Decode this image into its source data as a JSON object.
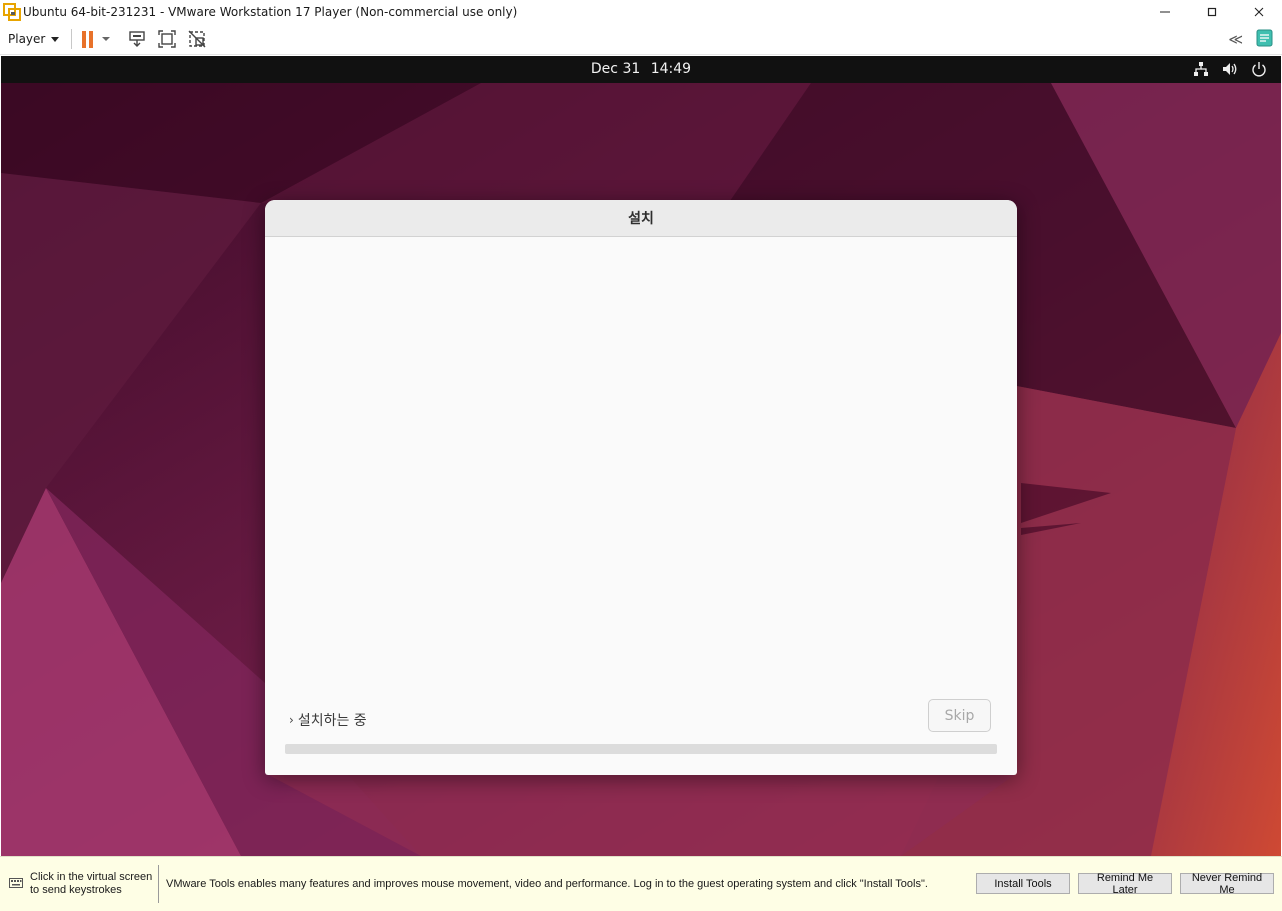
{
  "window": {
    "title": "Ubuntu 64-bit-231231 - VMware Workstation 17 Player (Non-commercial use only)",
    "controls": {
      "minimize": "—",
      "maximize": "☐",
      "close": "✕"
    }
  },
  "toolbar": {
    "player_label": "Player",
    "icons": [
      "pause-icon",
      "send-ctrl-alt-del-icon",
      "fullscreen-icon",
      "unity-icon",
      "collapse-icon",
      "message-log-icon"
    ],
    "collapse_glyph": "≪"
  },
  "guest": {
    "topbar": {
      "date": "Dec 31",
      "time": "14:49"
    },
    "tray_icons": [
      "network-icon",
      "volume-icon",
      "power-icon"
    ]
  },
  "installer": {
    "title": "설치",
    "status": "설치하는 중",
    "skip_label": "Skip",
    "progress": 0,
    "accent": "#e95420"
  },
  "notification": {
    "hint": "Click in the virtual screen to send keystrokes",
    "message": "VMware Tools enables many features and improves mouse movement, video and performance. Log in to the guest operating system and click \"Install Tools\".",
    "buttons": {
      "install": "Install Tools",
      "remind_later": "Remind Me Later",
      "never_remind": "Never Remind Me"
    }
  }
}
